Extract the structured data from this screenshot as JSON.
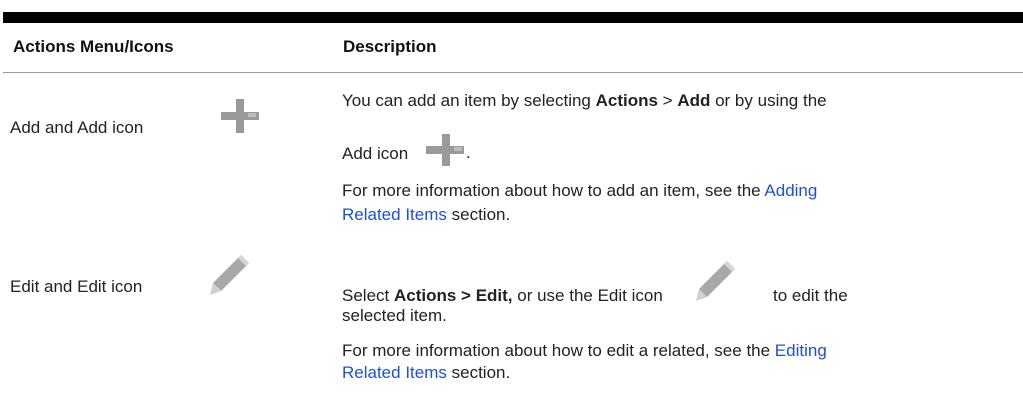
{
  "table": {
    "headers": {
      "actions": "Actions Menu/Icons",
      "description": "Description"
    },
    "rows": [
      {
        "label": "Add and Add icon",
        "icon": "plus-icon",
        "desc1": {
          "pre": "You can add an item by selecting ",
          "b1": "Actions",
          "mid": " > ",
          "b2": "Add",
          "post": " or by using the"
        },
        "desc1_line2": {
          "pre": "Add icon",
          "post": "."
        },
        "more": {
          "pre": "For more information about how to add an item, see the ",
          "link_part1": "Adding",
          "link_part2": "Related Items",
          "post": " section."
        }
      },
      {
        "label": "Edit and Edit icon",
        "icon": "pencil-icon",
        "desc1": {
          "pre": "Select ",
          "bold": "Actions > Edit,",
          "mid": " or use the Edit icon",
          "post": "to edit the"
        },
        "desc1_line2": "selected item.",
        "more": {
          "pre": "For more information about how to edit a related, see the ",
          "link_part1": "Editing",
          "link_part2": "Related Items",
          "post": " section."
        }
      }
    ]
  },
  "colors": {
    "link": "#1f4fd8",
    "icon_gray": "#9a9a9a",
    "rule": "#000000"
  }
}
